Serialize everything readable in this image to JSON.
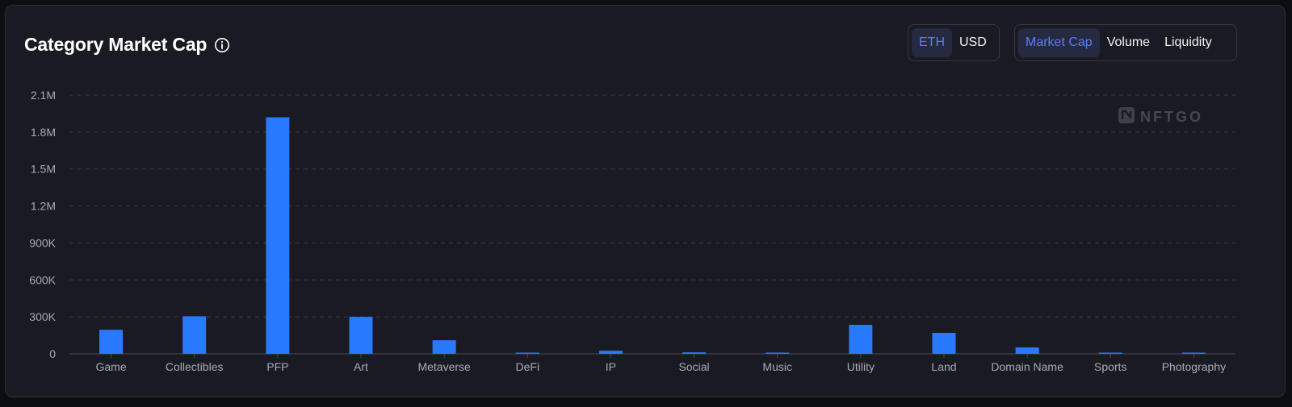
{
  "header": {
    "title": "Category Market Cap"
  },
  "currency_toggle": {
    "options": [
      {
        "label": "ETH",
        "active": true
      },
      {
        "label": "USD",
        "active": false
      }
    ]
  },
  "metric_toggle": {
    "options": [
      {
        "label": "Market Cap",
        "active": true
      },
      {
        "label": "Volume",
        "active": false
      },
      {
        "label": "Liquidity",
        "active": false
      }
    ]
  },
  "watermark": {
    "text": "NFTGO",
    "icon": "nftgo-logo-icon"
  },
  "colors": {
    "bar": "#2979ff",
    "accent": "#5b7cf7",
    "grid": "#3a3c47",
    "tick": "#a9abb3"
  },
  "chart_data": {
    "type": "bar",
    "categories": [
      "Game",
      "Collectibles",
      "PFP",
      "Art",
      "Metaverse",
      "DeFi",
      "IP",
      "Social",
      "Music",
      "Utility",
      "Land",
      "Domain Name",
      "Sports",
      "Photography"
    ],
    "values": [
      195000,
      305000,
      1920000,
      300000,
      110000,
      7000,
      25000,
      12000,
      10000,
      235000,
      170000,
      52000,
      4000,
      5000
    ],
    "yticks": [
      0,
      300000,
      600000,
      900000,
      1200000,
      1500000,
      1800000,
      2100000
    ],
    "ytick_labels": [
      "0",
      "300K",
      "600K",
      "900K",
      "1.2M",
      "1.5M",
      "1.8M",
      "2.1M"
    ],
    "ylim": [
      0,
      2100000
    ],
    "grid": true,
    "legend": "none"
  }
}
